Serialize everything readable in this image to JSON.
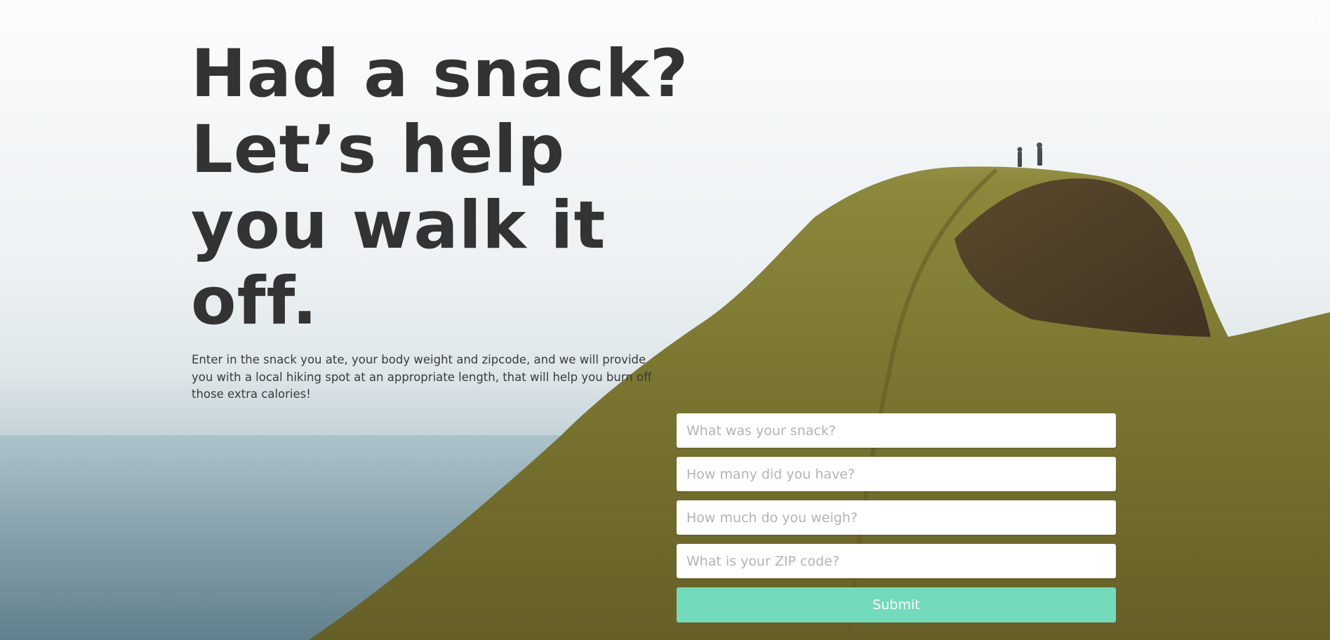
{
  "hero": {
    "headline_lines": [
      "Had a snack?",
      "Let’s help",
      "you walk it",
      "off."
    ],
    "intro": "Enter in the snack you ate, your body weight and zipcode, and we will provide you with a local hiking spot at an appropriate length, that will help you burn off those extra calories!"
  },
  "form": {
    "snack_placeholder": "What was your snack?",
    "quantity_placeholder": "How many did you have?",
    "weight_placeholder": "How much do you weigh?",
    "zip_placeholder": "What is your ZIP code?",
    "submit_label": "Submit"
  },
  "icons": {
    "close": "close-icon"
  },
  "colors": {
    "headline": "#333333",
    "submit": "#73dbbb",
    "grass": "#7b7a33",
    "sky": "#f4f6f7"
  }
}
